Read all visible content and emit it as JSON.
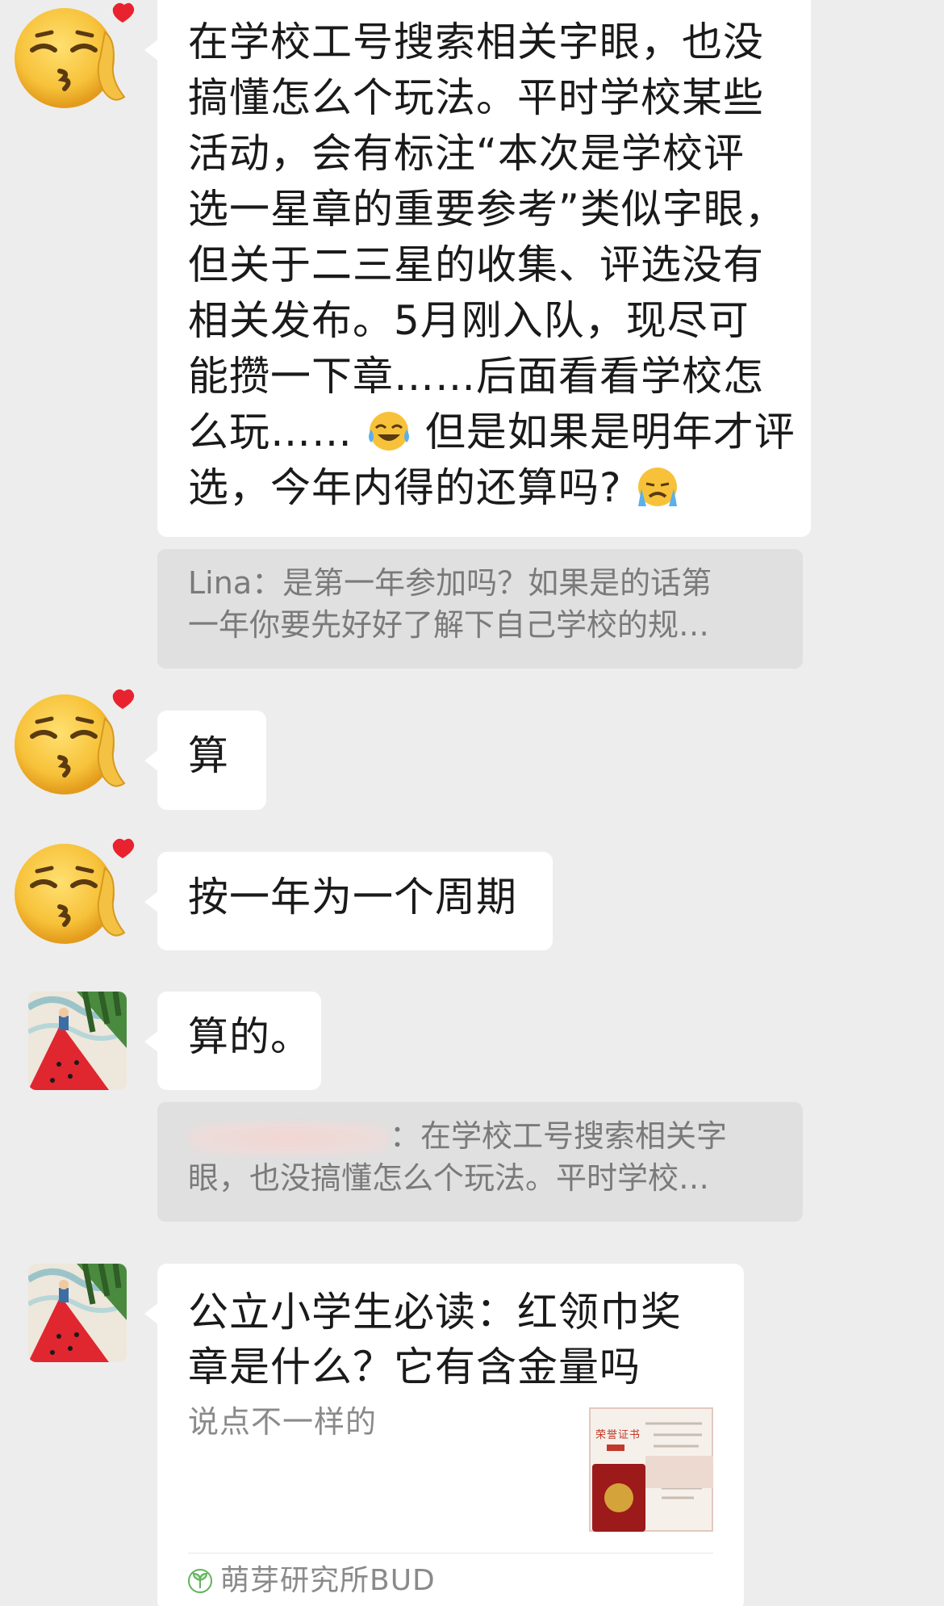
{
  "colors": {
    "background": "#ededed",
    "bubble": "#ffffff",
    "quote_bg": "#e0e0e0",
    "quote_text": "#7a7a7a",
    "source_icon": "#5fb35a"
  },
  "messages": [
    {
      "avatar": "kissing-emoji-avatar",
      "lines": [
        "在学校工号搜索相关字眼，也没",
        "搞懂怎么个玩法。平时学校某些",
        "活动，会有标注“本次是学校评",
        "选一星章的重要参考”类似字眼，",
        "但关于二三星的收集、评选没有",
        "相关发布。5月刚入队，现尽可",
        "能攒一下章……后面看看学校怎"
      ],
      "line8_a": "么玩……",
      "line8_b": "但是如果是明年才评",
      "line9_a": "选，今年内得的还算吗?",
      "quote_lines": [
        "Lina：是第一年参加吗？如果是的话第",
        "一年你要先好好了解下自己学校的规…"
      ]
    },
    {
      "avatar": "kissing-emoji-avatar",
      "text": "算"
    },
    {
      "avatar": "kissing-emoji-avatar",
      "text": "按一年为一个周期"
    },
    {
      "avatar": "watermelon-avatar",
      "text": "算的。",
      "quote_line1_suffix": "：在学校工号搜索相关字",
      "quote_line2": "眼，也没搞懂怎么个玩法。平时学校…"
    },
    {
      "avatar": "watermelon-avatar",
      "card": {
        "title_lines": [
          "公立小学生必读：红领巾奖",
          "章是什么？它有含金量吗"
        ],
        "description": "说点不一样的",
        "source": "萌芽研究所BUD",
        "thumb_label": "荣誉证书"
      }
    }
  ]
}
